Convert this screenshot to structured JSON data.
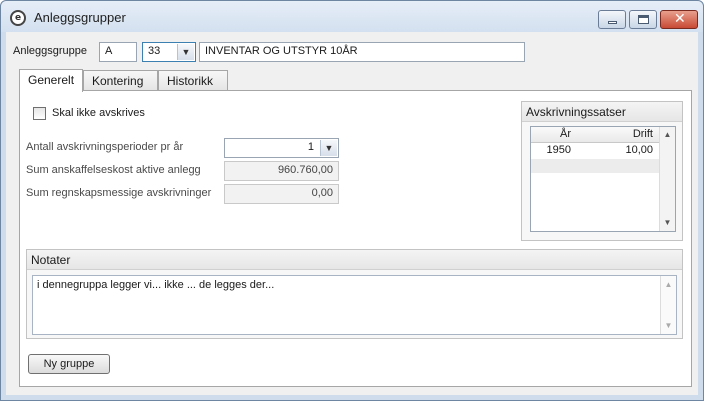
{
  "window": {
    "title": "Anleggsgrupper",
    "app_icon": "app-logo-icon"
  },
  "header": {
    "group_label": "Anleggsgruppe",
    "group_code": "A",
    "sub_code": "33",
    "description": "INVENTAR OG UTSTYR 10ÅR"
  },
  "tabs": [
    {
      "label": "Generelt",
      "active": true
    },
    {
      "label": "Kontering",
      "active": false
    },
    {
      "label": "Historikk",
      "active": false
    }
  ],
  "general": {
    "skip_depreciation_label": "Skal ikke avskrives",
    "skip_depreciation_checked": false,
    "periods_label": "Antall avskrivningsperioder pr år",
    "periods_value": "1",
    "acquisition_label": "Sum anskaffelseskost aktive anlegg",
    "acquisition_value": "960.760,00",
    "accounting_label": "Sum regnskapsmessige avskrivninger",
    "accounting_value": "0,00"
  },
  "rates": {
    "title": "Avskrivningssatser",
    "columns": [
      "År",
      "Drift"
    ],
    "rows": [
      {
        "year": "1950",
        "drift": "10,00"
      }
    ]
  },
  "notes": {
    "title": "Notater",
    "text": "i dennegruppa legger vi... ikke ... de legges der..."
  },
  "buttons": {
    "new_group": "Ny gruppe"
  },
  "colors": {
    "titlebar": "#d3e0ef",
    "close": "#c84a35",
    "panel": "#ffffff"
  }
}
